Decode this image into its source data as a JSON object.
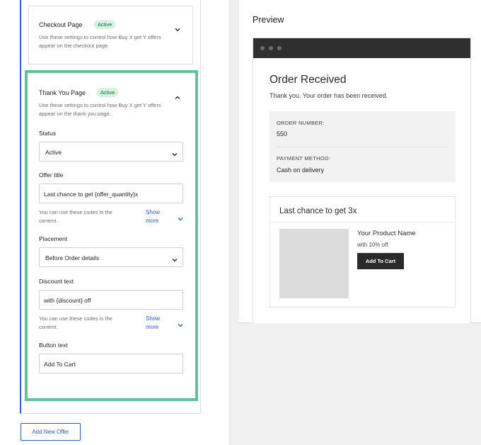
{
  "left": {
    "checkout_card": {
      "title": "Checkout Page",
      "badge": "Active",
      "description": "Use these settings to control how Buy X get Y offers appear on the checkout page."
    },
    "thankyou_card": {
      "title": "Thank You Page",
      "badge": "Active",
      "description": "Use these settings to control how Buy X get Y offers appear on the thank you page.",
      "status_label": "Status",
      "status_value": "Active",
      "offer_title_label": "Offer title",
      "offer_title_value": "Last chance to get {offer_quantity}x",
      "offer_title_help": "You can use these codes in the content.",
      "offer_title_show_more": "Show more",
      "placement_label": "Placement",
      "placement_value": "Before Order details",
      "discount_label": "Discount text",
      "discount_value": "with {discount} off",
      "discount_help": "You can use these codes in the content.",
      "discount_show_more": "Show more",
      "button_label": "Button text",
      "button_value": "Add To Cart"
    },
    "add_offer_button": "Add New Offer"
  },
  "preview": {
    "heading": "Preview",
    "order_title": "Order Received",
    "order_subtitle": "Thank you. Your order has been received.",
    "order_number_label": "ORDER NUMBER:",
    "order_number_value": "550",
    "payment_label": "PAYMENT METHOD:",
    "payment_value": "Cash on delivery",
    "offer_title": "Last chance to get 3x",
    "product_name": "Your Product Name",
    "product_discount": "with 10% off",
    "add_to_cart": "Add To Cart"
  },
  "colors": {
    "accent_blue": "#2a59c7",
    "highlight_green": "#5fc39a",
    "badge_bg": "#d7f2e1",
    "browser_bar": "#2f2f2f",
    "cart_button": "#2b2b2b"
  },
  "icons": {
    "expand": "chevron-down-icon",
    "collapse": "chevron-up-icon",
    "select_caret": "chevron-down-icon"
  }
}
